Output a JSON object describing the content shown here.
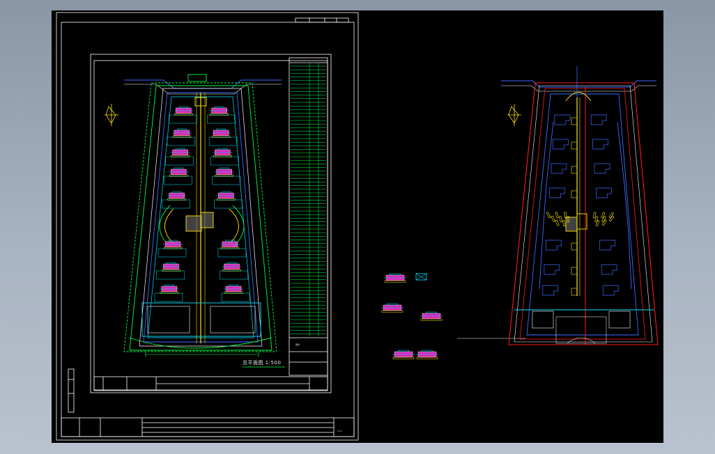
{
  "window": {
    "background": "#000000",
    "accent": "#ffffff"
  },
  "sheet_left": {
    "scale_label": "总平面图 1:500",
    "legend_title": "图例",
    "footer_code": "C-01"
  },
  "colors": {
    "frame": "#ffffff",
    "road": "#2b57ff",
    "green": "#00ff44",
    "cyan": "#00e6ff",
    "yellow": "#ffe600",
    "magenta": "#ff2bd6",
    "red": "#ff1a1a",
    "blue": "#3c6bff"
  }
}
